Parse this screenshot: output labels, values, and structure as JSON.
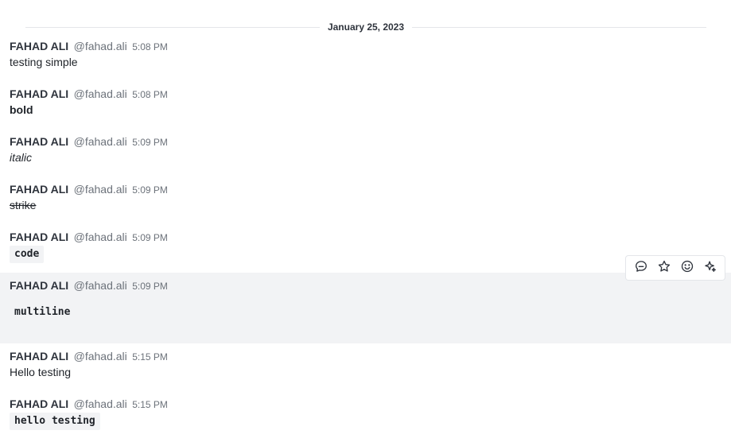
{
  "date_divider": "January 25, 2023",
  "messages": [
    {
      "author": "FAHAD ALI",
      "username": "@fahad.ali",
      "time": "5:08 PM",
      "text": "testing simple"
    },
    {
      "author": "FAHAD ALI",
      "username": "@fahad.ali",
      "time": "5:08 PM",
      "text": "bold"
    },
    {
      "author": "FAHAD ALI",
      "username": "@fahad.ali",
      "time": "5:09 PM",
      "text": "italic"
    },
    {
      "author": "FAHAD ALI",
      "username": "@fahad.ali",
      "time": "5:09 PM",
      "text": "strike"
    },
    {
      "author": "FAHAD ALI",
      "username": "@fahad.ali",
      "time": "5:09 PM",
      "text": "code"
    },
    {
      "author": "FAHAD ALI",
      "username": "@fahad.ali",
      "time": "5:09 PM",
      "text": "multiline"
    },
    {
      "author": "FAHAD ALI",
      "username": "@fahad.ali",
      "time": "5:15 PM",
      "text": "Hello testing"
    },
    {
      "author": "FAHAD ALI",
      "username": "@fahad.ali",
      "time": "5:15 PM",
      "text": "hello testing"
    }
  ],
  "toolbar": {
    "icons": [
      "reply-in-thread-icon",
      "star-icon",
      "emoji-icon",
      "ai-sparkle-icon"
    ]
  }
}
